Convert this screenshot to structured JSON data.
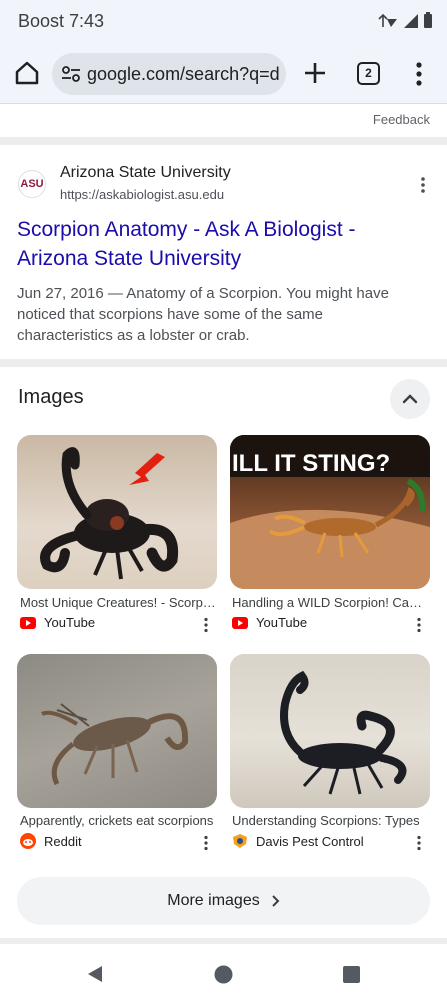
{
  "status": {
    "time": "Boost 7:43"
  },
  "browser": {
    "url": "google.com/search?q=d",
    "tab_count": "2"
  },
  "feedback": "Feedback",
  "result": {
    "site_logo_text": "ASU",
    "site_name": "Arizona State University",
    "site_url": "https://askabiologist.asu.edu",
    "title": "Scorpion Anatomy - Ask A Biologist - Arizona State University",
    "snippet": "Jun 27, 2016 — Anatomy of a Scorpion. You might have noticed that scorpions have some of the same characteristics as a lobster or crab."
  },
  "images": {
    "heading": "Images",
    "items": [
      {
        "caption": "Most Unique Creatures! - Scorpion",
        "source": "YouTube",
        "source_icon": "youtube-icon"
      },
      {
        "caption": "Handling a WILD Scorpion! Can It Sting?",
        "source": "YouTube",
        "source_icon": "youtube-icon",
        "overlay_text": "ILL IT STING?"
      },
      {
        "caption": "Apparently, crickets eat scorpions",
        "source": "Reddit",
        "source_icon": "reddit-icon"
      },
      {
        "caption": "Understanding Scorpions: Types",
        "source": "Davis Pest Control",
        "source_icon": "davis-pest-icon"
      }
    ],
    "more_label": "More images"
  },
  "colors": {
    "link": "#1a0dab",
    "youtube": "#ff0000",
    "reddit": "#ff4500",
    "asu": "#8c1d40"
  }
}
